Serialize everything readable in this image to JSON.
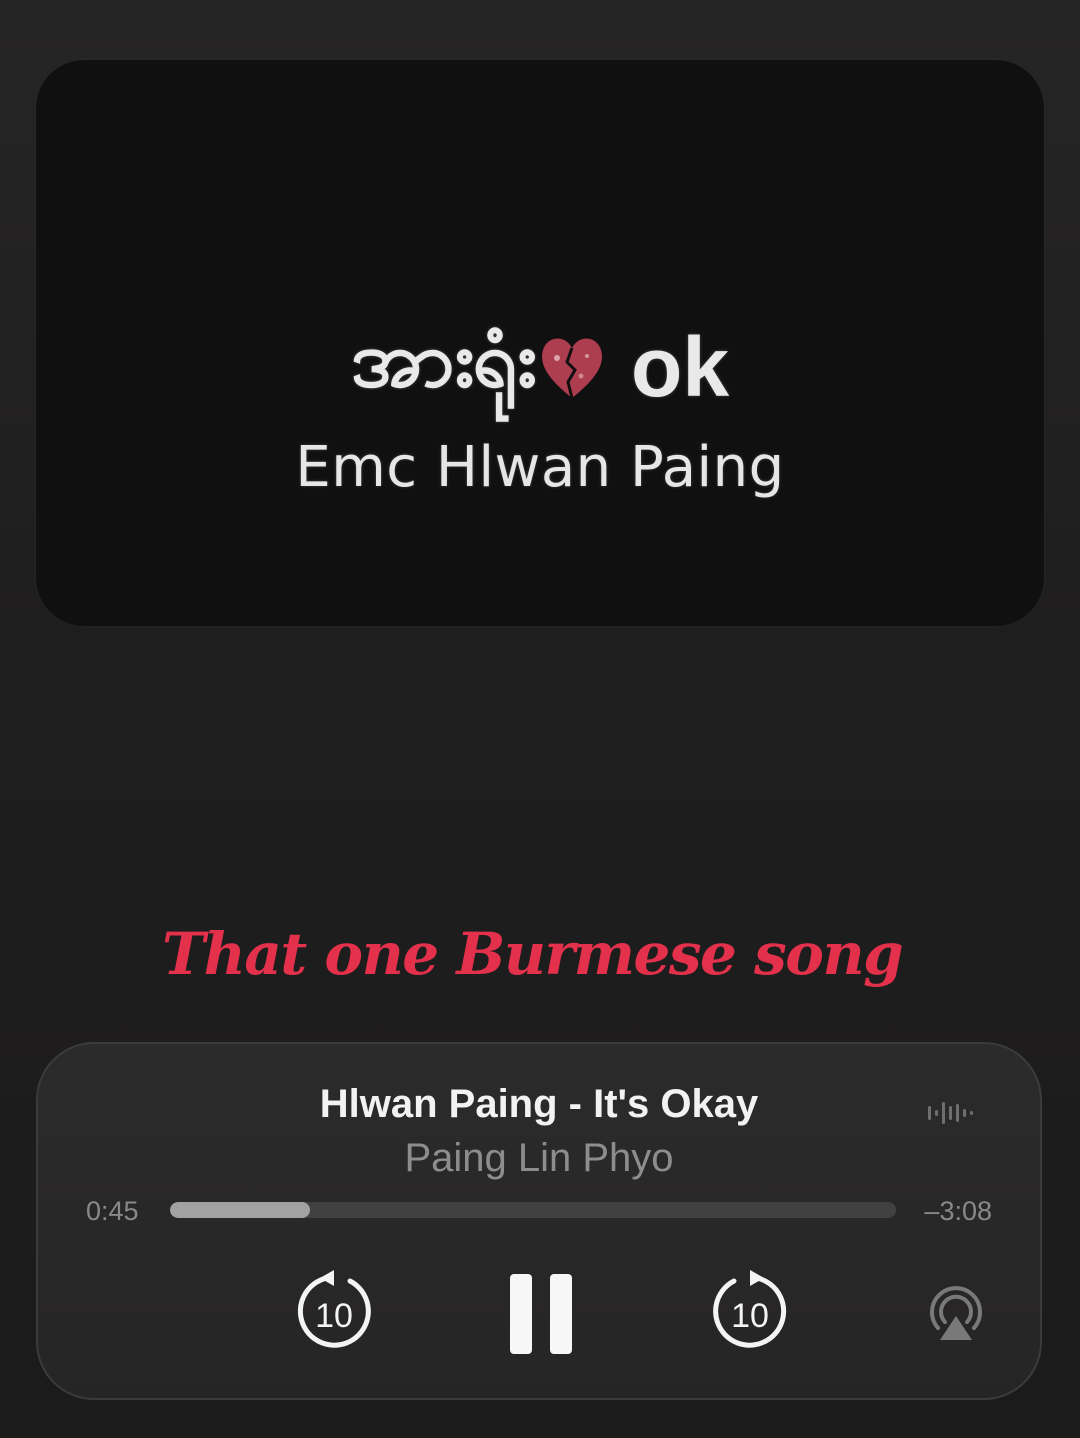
{
  "artwork": {
    "title_burmese": "အားရုံး",
    "title_latin": "ok",
    "artist": "Emc Hlwan Paing"
  },
  "caption": "That one Burmese song",
  "player": {
    "song_title": "Hlwan Paing - It's Okay",
    "artist": "Paing Lin Phyo",
    "elapsed": "0:45",
    "remaining": "–3:08",
    "progress_fraction": 0.193,
    "skip_back_seconds": "10",
    "skip_forward_seconds": "10",
    "icons": {
      "waveform": "waveform-icon",
      "rewind": "skip-back-10-icon",
      "pause": "pause-icon",
      "forward": "skip-forward-10-icon",
      "airplay": "airplay-icon"
    }
  },
  "colors": {
    "background": "#1f1e1e",
    "card": "#2a2929",
    "caption": "#e3314c",
    "progress_fill": "#a3a2a2",
    "progress_track": "#424141"
  }
}
